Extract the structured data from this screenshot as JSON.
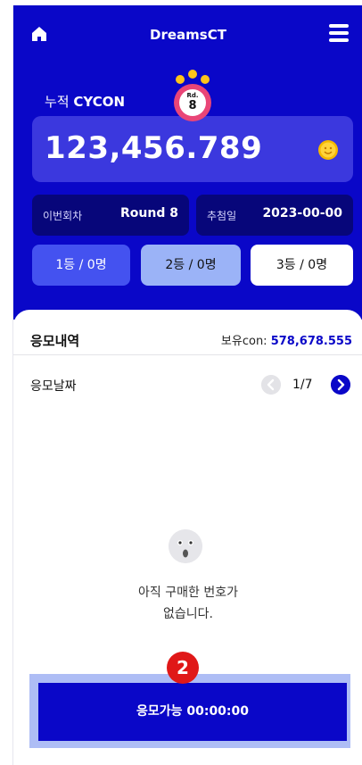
{
  "header": {
    "title": "DreamsCT",
    "home_icon": "home-icon",
    "menu_icon": "hamburger-menu-icon"
  },
  "jackpot": {
    "label_prefix": "누적",
    "label_currency": "CYCON",
    "amount": "123,456.789",
    "coin_icon": "coin-smile-icon"
  },
  "round_badge": {
    "prefix": "Rd.",
    "number": "8"
  },
  "round_info": {
    "current_label": "이번회차",
    "current_value": "Round 8",
    "draw_label": "추첨일",
    "draw_value": "2023-00-00"
  },
  "ranks": [
    {
      "label": "1등 / 0명",
      "bg": "#4452f0",
      "fg": "#ffffff"
    },
    {
      "label": "2등 / 0명",
      "bg": "#9bb3f7",
      "fg": "#111111"
    },
    {
      "label": "3등 / 0명",
      "bg": "#ffffff",
      "fg": "#111111"
    }
  ],
  "history": {
    "title": "응모내역",
    "holding_label": "보유con:",
    "holding_value": "578,678.555",
    "date_label": "응모날짜",
    "page": "1/7",
    "empty_line1": "아직 구매한 번호가",
    "empty_line2": "없습니다."
  },
  "cta": {
    "label": "응모가능 00:00:00",
    "step": "2"
  },
  "colors": {
    "primary": "#0a07c8",
    "card": "#3b38de",
    "dark": "#07067a",
    "accent": "#ffc41a",
    "alert": "#e01818"
  }
}
